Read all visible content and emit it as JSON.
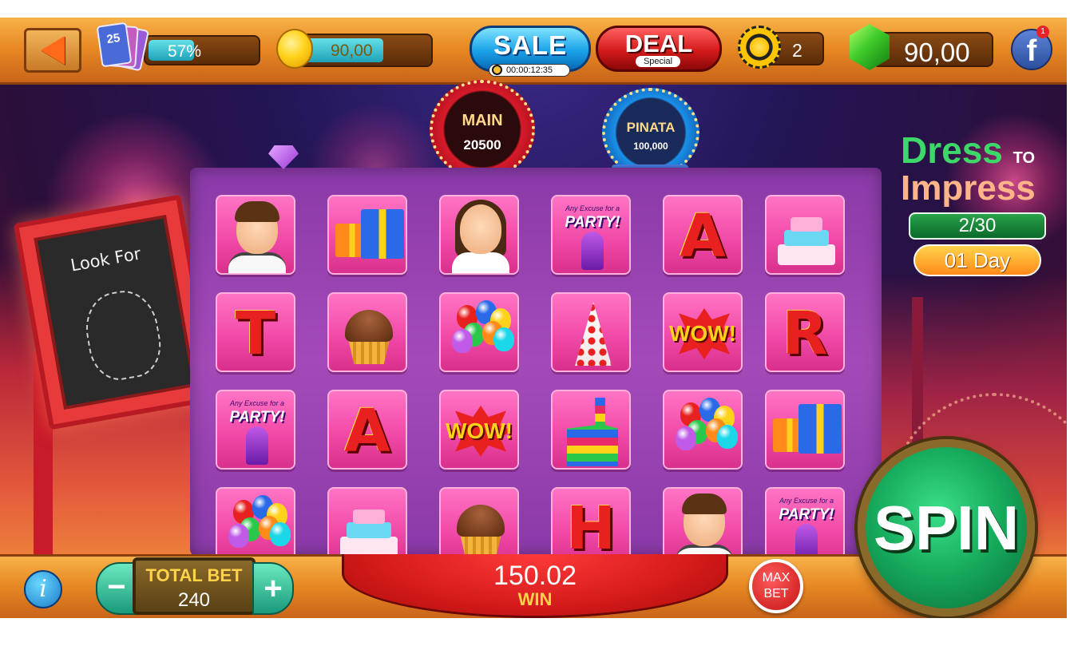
{
  "top_bar": {
    "level_badge": "25",
    "level_progress_percent": 57,
    "level_progress_text": "57%",
    "coins_value": "90,00",
    "sale_label": "SALE",
    "sale_timer": "00:00:12:35",
    "deal_label": "DEAL",
    "deal_sublabel": "Special",
    "chips_count": "2",
    "gems_value": "90,00",
    "facebook_label": "f",
    "facebook_badge": "1"
  },
  "jackpots": [
    {
      "title": "MAIN",
      "value": "20500"
    },
    {
      "title": "PINATA",
      "value": "100,000"
    }
  ],
  "look_for": {
    "title": "Look For",
    "target_icon": "teddy-bear-icon"
  },
  "event": {
    "title_line1": "Dress",
    "title_to": "TO",
    "title_line2": "Impress",
    "progress": "2/30",
    "time_left": "01 Day"
  },
  "reels": {
    "rows": [
      [
        "man",
        "gifts",
        "woman",
        "party",
        "A",
        "cake"
      ],
      [
        "T",
        "cupcake",
        "balloons",
        "party-hat",
        "wow",
        "R"
      ],
      [
        "party",
        "A",
        "wow",
        "pinata",
        "balloons",
        "gifts"
      ],
      [
        "balloons",
        "cake",
        "cupcake",
        "H",
        "man",
        "party"
      ]
    ],
    "party_small": "Any Excuse for a",
    "party_big": "PARTY!",
    "wow_text": "WOW!"
  },
  "bottom_bar": {
    "info_label": "i",
    "minus_label": "−",
    "plus_label": "+",
    "total_bet_label": "TOTAL BET",
    "total_bet_value": "240",
    "win_value": "150.02",
    "win_label": "WIN",
    "max_bet_line1": "MAX",
    "max_bet_line2": "BET",
    "spin_label": "SPIN"
  },
  "colors": {
    "bar_orange": "#e98a24",
    "reel_purple": "#a44ab8",
    "tile_pink": "#f24aa8",
    "spin_green": "#15a85a"
  }
}
